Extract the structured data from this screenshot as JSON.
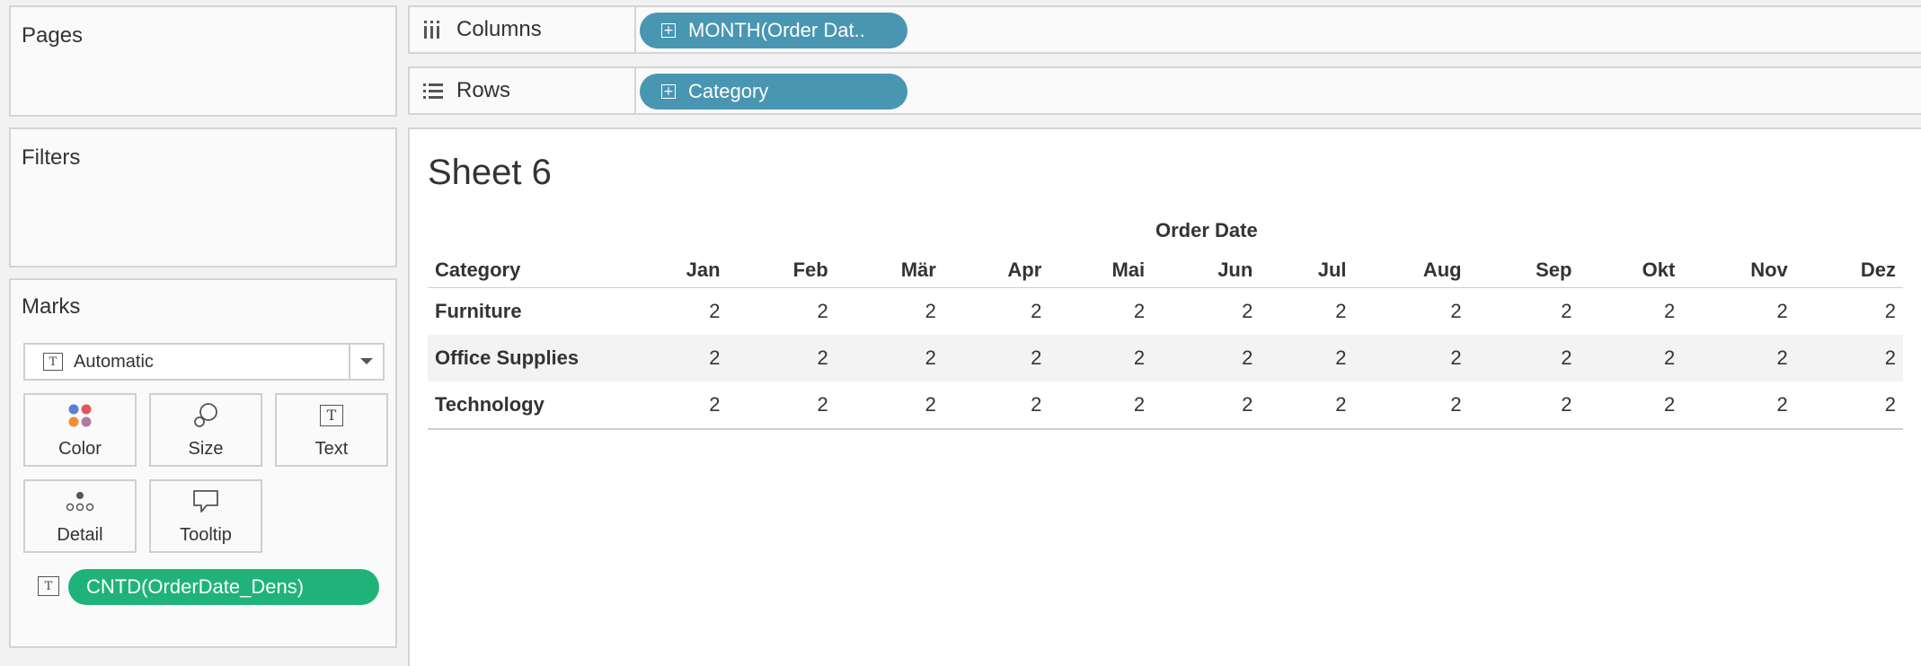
{
  "pages": {
    "title": "Pages"
  },
  "filters": {
    "title": "Filters"
  },
  "marks": {
    "title": "Marks",
    "mark_type": "Automatic",
    "buttons": [
      {
        "label": "Color",
        "icon": "color-dots-icon"
      },
      {
        "label": "Size",
        "icon": "size-circles-icon"
      },
      {
        "label": "Text",
        "icon": "text-t-icon"
      },
      {
        "label": "Detail",
        "icon": "detail-dots-icon"
      },
      {
        "label": "Tooltip",
        "icon": "tooltip-bubble-icon"
      }
    ],
    "pill": "CNTD(OrderDate_Dens)"
  },
  "shelves": {
    "columns": {
      "label": "Columns",
      "pill": "MONTH(Order Dat.."
    },
    "rows": {
      "label": "Rows",
      "pill": "Category"
    }
  },
  "sheet": {
    "title": "Sheet 6",
    "column_header": "Order Date",
    "row_header": "Category",
    "months": [
      "Jan",
      "Feb",
      "Mär",
      "Apr",
      "Mai",
      "Jun",
      "Jul",
      "Aug",
      "Sep",
      "Okt",
      "Nov",
      "Dez"
    ],
    "rows": [
      {
        "category": "Furniture",
        "values": [
          "2",
          "2",
          "2",
          "2",
          "2",
          "2",
          "2",
          "2",
          "2",
          "2",
          "2",
          "2"
        ]
      },
      {
        "category": "Office Supplies",
        "values": [
          "2",
          "2",
          "2",
          "2",
          "2",
          "2",
          "2",
          "2",
          "2",
          "2",
          "2",
          "2"
        ]
      },
      {
        "category": "Technology",
        "values": [
          "2",
          "2",
          "2",
          "2",
          "2",
          "2",
          "2",
          "2",
          "2",
          "2",
          "2",
          "2"
        ]
      }
    ]
  },
  "colors": {
    "pill_blue": "#4996b2",
    "pill_green": "#1fb37a"
  }
}
